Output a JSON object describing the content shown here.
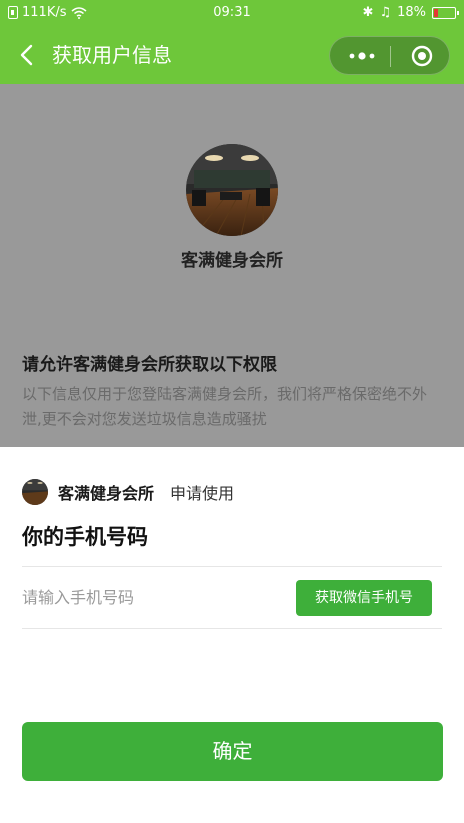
{
  "status_bar": {
    "network_speed": "111K/s",
    "time": "09:31",
    "battery": "18%",
    "icons": [
      "sim-icon",
      "wifi-icon",
      "bluetooth-icon",
      "alarm-icon",
      "battery-icon"
    ],
    "battery_level": 0.18
  },
  "nav": {
    "title": "获取用户信息",
    "icons": [
      "back-icon",
      "more-icon",
      "target-icon"
    ]
  },
  "overlay": {
    "app_name": "客满健身会所",
    "permission_title": "请允许客满健身会所获取以下权限",
    "permission_desc": "以下信息仅用于您登陆客满健身会所，我们将严格保密绝不外泄,更不会对您发送垃圾信息造成骚扰"
  },
  "sheet": {
    "applicant_name": "客满健身会所",
    "applicant_action": "申请使用",
    "request_title": "你的手机号码",
    "phone_input_value": "",
    "phone_input_placeholder": "请输入手机号码",
    "get_phone_label": "获取微信手机号",
    "confirm_label": "确定"
  },
  "colors": {
    "brand_green": "#6ec73a",
    "button_green": "#3eaf3a",
    "overlay_gray": "#999999"
  }
}
